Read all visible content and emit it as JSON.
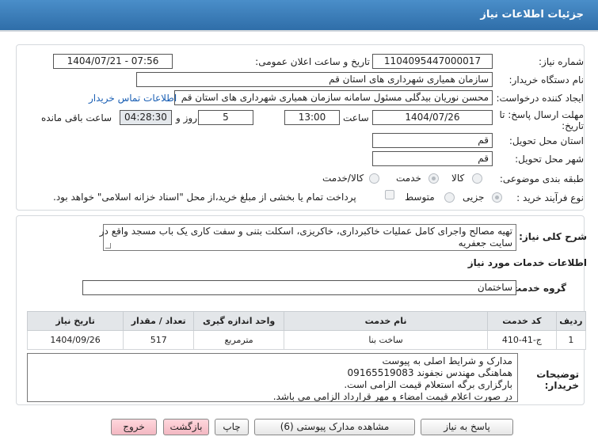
{
  "window": {
    "title": "جزئیات اطلاعات نیاز"
  },
  "fields": {
    "need_number_label": "شماره نیاز:",
    "need_number": "1104095447000017",
    "announce_label": "تاریخ و ساعت اعلان عمومی:",
    "announce_value": "1404/07/21 - 07:56",
    "buyer_label": "نام دستگاه خریدار:",
    "buyer_value": "سازمان همیاری شهرداری های استان قم",
    "creator_label": "ایجاد کننده درخواست:",
    "creator_value": "محسن نوریان بیدگلی مسئول سامانه سازمان همیاری شهرداری های استان قم",
    "contact_link": "اطلاعات تماس خریدار",
    "deadline_label_1": "مهلت ارسال پاسخ: تا",
    "deadline_label_2": "تاریخ:",
    "deadline_date": "1404/07/26",
    "time_label": "ساعت",
    "deadline_time": "13:00",
    "days_value": "5",
    "days_label": "روز و",
    "remaining_value": "04:28:30",
    "remaining_label": "ساعت باقی مانده",
    "province_label": "استان محل تحویل:",
    "province_value": "قم",
    "city_label": "شهر محل تحویل:",
    "city_value": "قم",
    "category_label": "طبقه بندی موضوعی:",
    "category_options": [
      "کالا",
      "خدمت",
      "کالا/خدمت"
    ],
    "process_label": "نوع فرآیند خرید :",
    "process_options": [
      "جزیی",
      "متوسط"
    ],
    "payment_note": "پرداخت تمام یا بخشی از مبلغ خرید،از محل \"اسناد خزانه اسلامی\" خواهد بود."
  },
  "description": {
    "label": "شرح کلی نیاز:",
    "text_line1": "تهیه مصالح واجرای کامل عملیات خاکبرداری، خاکریزی، اسکلت بتنی و سفت کاری یک باب مسجد واقع در",
    "text_line2": "سایت جعفریه"
  },
  "services": {
    "heading": "اطلاعات خدمات مورد نیاز",
    "group_label": "گروه خدمت:",
    "group_value": "ساختمان",
    "columns": [
      "ردیف",
      "کد خدمت",
      "نام خدمت",
      "واحد اندازه گیری",
      "تعداد / مقدار",
      "تاریخ نیاز"
    ],
    "rows": [
      [
        "1",
        "ج-41-410",
        "ساخت بنا",
        "مترمربع",
        "517",
        "1404/09/26"
      ]
    ]
  },
  "buyer_notes": {
    "label_line1": "توضیحات",
    "label_line2": "خریدار:",
    "lines": [
      "مدارک و شرایط اصلی به پیوست",
      "هماهنگی مهندس نجفوند 09165519083",
      "بارگزاری برگه استعلام قیمت الزامی است.",
      "در صورت اعلام قیمت امضاء و مهر قرارداد الزامی می باشد."
    ]
  },
  "buttons": {
    "reply": "پاسخ به نیاز",
    "view_docs": "مشاهده مدارک پیوستی (6)",
    "print": "چاپ",
    "back": "بازگشت",
    "exit": "خروج"
  }
}
